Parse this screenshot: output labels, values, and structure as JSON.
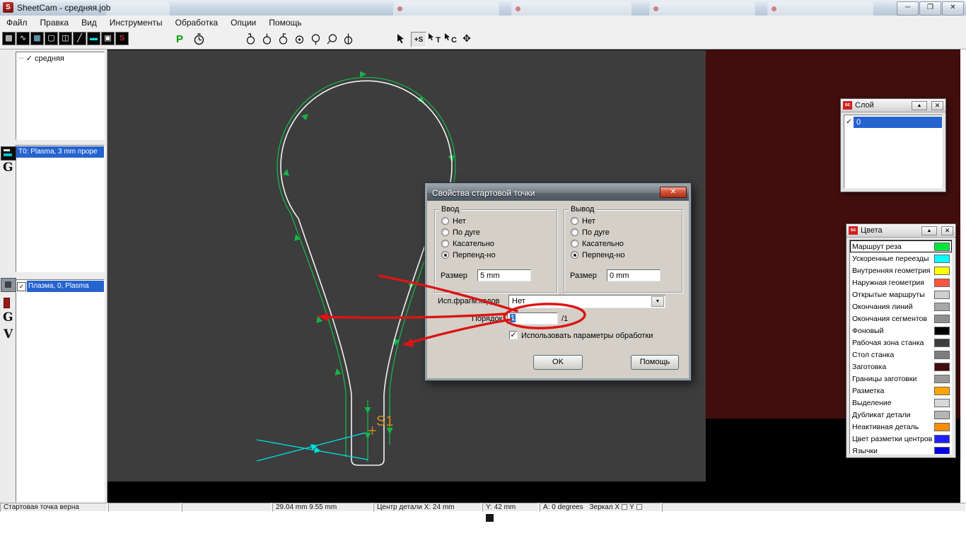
{
  "window": {
    "title": "SheetCam - средняя.job"
  },
  "window_controls": {
    "minimize": "─",
    "maximize": "❐",
    "close": "✕"
  },
  "menu": {
    "items": [
      "Файл",
      "Правка",
      "Вид",
      "Инструменты",
      "Обработка",
      "Опции",
      "Помощь"
    ]
  },
  "toolbar": {
    "post_label": "P",
    "view_icons": [
      {
        "name": "parts-view",
        "glyph": "▩",
        "color": "#ffffff"
      },
      {
        "name": "path-view",
        "glyph": "∿",
        "color": "#ffffff"
      },
      {
        "name": "grid-view",
        "glyph": "▦",
        "color": "#8fd8ff"
      },
      {
        "name": "outline-view",
        "glyph": "▢",
        "color": "#ffffff"
      },
      {
        "name": "split-view",
        "glyph": "◫",
        "color": "#ffffff"
      },
      {
        "name": "diagonal-view",
        "glyph": "╱",
        "color": "#ffffff"
      },
      {
        "name": "panel-view",
        "glyph": "▬",
        "color": "#00e5e5"
      },
      {
        "name": "solid-view",
        "glyph": "▣",
        "color": "#ffffff"
      },
      {
        "name": "sheetcam-logo",
        "glyph": "S",
        "color": "#ff4136"
      }
    ]
  },
  "sidebar": {
    "part_item": "средняя",
    "tool_item": "T0: Plasma, 3 mm проре",
    "operation_item": "Плазма, 0, Plasma",
    "gutter_g1": "G",
    "gutter_g2": "G",
    "gutter_v": "V"
  },
  "canvas": {
    "start_point_label": "S1"
  },
  "dialog": {
    "title": "Свойства стартовой точки",
    "input_group": {
      "label": "Ввод",
      "options": [
        "Нет",
        "По дуге",
        "Касательно",
        "Перпенд-но"
      ],
      "size_label": "Размер",
      "size_value": "5 mm"
    },
    "output_group": {
      "label": "Вывод",
      "options": [
        "Нет",
        "По дуге",
        "Касательно",
        "Перпенд-но"
      ],
      "size_label": "Размер",
      "size_value": "0 mm"
    },
    "snippets_label": "Исп.фрагм.кодов",
    "snippets_value": "Нет",
    "order_label": "Порядок",
    "order_value": "1",
    "order_suffix": "/1",
    "use_params_label": "Использовать параметры обработки",
    "ok_label": "OK",
    "help_label": "Помощь"
  },
  "layer_palette": {
    "title": "Слой",
    "row_label": "0"
  },
  "colors_palette": {
    "title": "Цвета",
    "items": [
      {
        "label": "Маршрут реза",
        "color": "#00e53c"
      },
      {
        "label": "Ускоренные переезды",
        "color": "#00ffff"
      },
      {
        "label": "Внутренняя геометрия",
        "color": "#ffff00"
      },
      {
        "label": "Наружная геометрия",
        "color": "#ff5540"
      },
      {
        "label": "Открытые маршруты",
        "color": "#cfcfcf"
      },
      {
        "label": "Окончания линий",
        "color": "#a8a8a8"
      },
      {
        "label": "Окончания сегментов",
        "color": "#8f8f8f"
      },
      {
        "label": "Фоновый",
        "color": "#000000"
      },
      {
        "label": "Рабочая зона станка",
        "color": "#3d3d3d"
      },
      {
        "label": "Стол станка",
        "color": "#7d7d7d"
      },
      {
        "label": "Заготовка",
        "color": "#420d0d"
      },
      {
        "label": "Границы заготовки",
        "color": "#9a9a9a"
      },
      {
        "label": "Разметка",
        "color": "#ffa500"
      },
      {
        "label": "Выделение",
        "color": "#d8d8d8"
      },
      {
        "label": "Дубликат детали",
        "color": "#b5b5b5"
      },
      {
        "label": "Неактивная деталь",
        "color": "#ff8c00"
      },
      {
        "label": "Цвет разметки центров",
        "color": "#2020ff"
      },
      {
        "label": "Язычки",
        "color": "#0000e0"
      }
    ]
  },
  "statusbar": {
    "message": "Стартовая точка верна",
    "cursor_position": "29.04 mm  9.55 mm",
    "part_center_x": "Центр детали X: 24 mm",
    "part_center_y": "Y: 42 mm",
    "angle": "A: 0 degrees",
    "mirror_x_label": "Зеркал X",
    "mirror_y_label": "Y"
  },
  "icons": {
    "check": "✓",
    "combo_arrow": "▼",
    "palette_up": "▲",
    "palette_close": "✕",
    "move_tool": "✥",
    "app_logo": "S",
    "plus_s": "+S",
    "tool_t": "T",
    "tool_c": "C"
  }
}
